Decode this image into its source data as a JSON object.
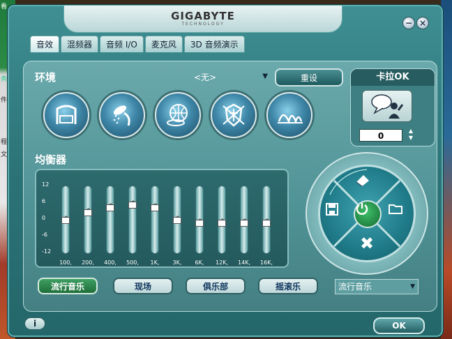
{
  "header": {
    "logo": "GIGABYTE",
    "logo_sub": "TECHNOLOGY",
    "minimize_symbol": "−",
    "close_symbol": "×"
  },
  "tabs": [
    {
      "label": "音效",
      "active": true
    },
    {
      "label": "混频器",
      "active": false
    },
    {
      "label": "音频 I/O",
      "active": false
    },
    {
      "label": "麦克风",
      "active": false
    },
    {
      "label": "3D 音频演示",
      "active": false
    }
  ],
  "environment": {
    "label": "环境",
    "selected": "<无>",
    "reset_label": "重设",
    "icons": [
      "room-icon",
      "shower-icon",
      "sphere-icon",
      "armor-icon",
      "opera-house-icon"
    ]
  },
  "karaoke": {
    "title": "卡拉OK",
    "value": "0"
  },
  "equalizer": {
    "label": "均衡器",
    "db_labels": [
      "12",
      "6",
      "0",
      "-6",
      "-12"
    ],
    "bands": [
      {
        "freq": "100,",
        "level": 0
      },
      {
        "freq": "200,",
        "level": 3
      },
      {
        "freq": "400,",
        "level": 5
      },
      {
        "freq": "500,",
        "level": 6
      },
      {
        "freq": "1K,",
        "level": 5
      },
      {
        "freq": "3K,",
        "level": 0
      },
      {
        "freq": "6K,",
        "level": -1
      },
      {
        "freq": "12K,",
        "level": -1
      },
      {
        "freq": "14K,",
        "level": -1
      },
      {
        "freq": "16K,",
        "level": -1
      }
    ]
  },
  "presets": {
    "buttons": [
      {
        "label": "流行音乐",
        "active": true
      },
      {
        "label": "现场",
        "active": false
      },
      {
        "label": "俱乐部",
        "active": false
      },
      {
        "label": "摇滚乐",
        "active": false
      }
    ],
    "selected": "流行音乐"
  },
  "footer": {
    "info_label": "i",
    "ok_label": "OK"
  },
  "colors": {
    "window": "#2b7377",
    "panel": "#5a9c9f",
    "active_preset": "#2a8a4c",
    "accent_text": "#10365f"
  }
}
